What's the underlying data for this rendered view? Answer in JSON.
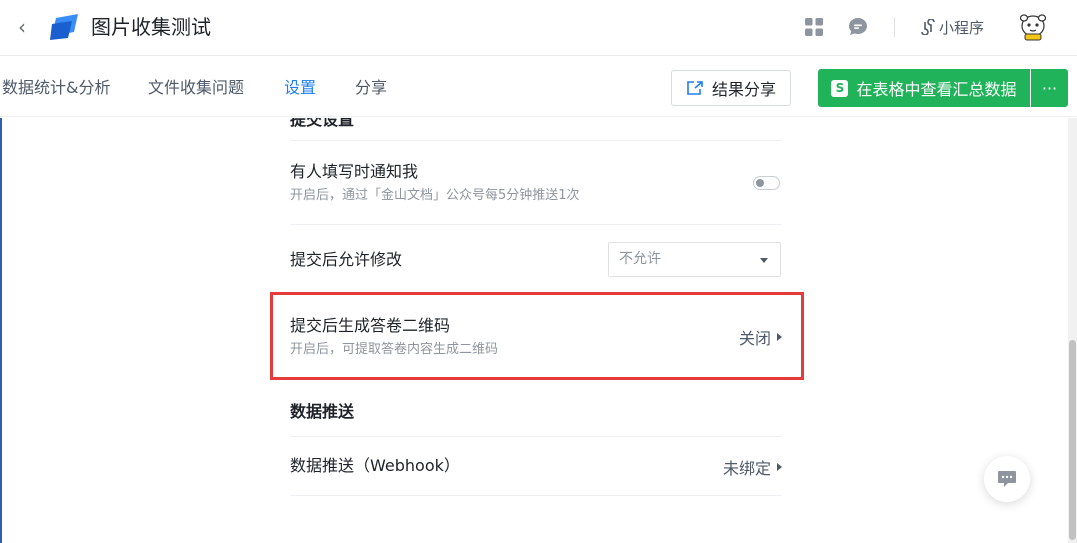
{
  "header": {
    "title": "图片收集测试",
    "mini_program_label": "小程序",
    "icons": {
      "back": "chevron-left-icon",
      "logo": "form-logo-icon",
      "grid": "grid-icon",
      "chat": "chat-bubble-icon",
      "link": "link-icon",
      "avatar": "mascot-avatar"
    }
  },
  "tabs": [
    {
      "label": "数据统计&分析",
      "active": false
    },
    {
      "label": "文件收集问题",
      "active": false
    },
    {
      "label": "设置",
      "active": true
    },
    {
      "label": "分享",
      "active": false
    }
  ],
  "toolbar": {
    "share_label": "结果分享",
    "sheet_badge": "S",
    "sheet_label": "在表格中查看汇总数据",
    "more_label": "···"
  },
  "settings": {
    "partial_section": "提交设置",
    "notify": {
      "title": "有人填写时通知我",
      "desc": "开启后，通过「金山文档」公众号每5分钟推送1次",
      "enabled": false
    },
    "allow_edit": {
      "title": "提交后允许修改",
      "value": "不允许"
    },
    "qrcode": {
      "title": "提交后生成答卷二维码",
      "desc": "开启后，可提取答卷内容生成二维码",
      "value": "关闭"
    },
    "push_section": "数据推送",
    "webhook": {
      "title": "数据推送（Webhook）",
      "value": "未绑定"
    }
  },
  "colors": {
    "accent": "#1f7ff0",
    "green": "#21b35a",
    "highlight": "#e63b3b"
  }
}
